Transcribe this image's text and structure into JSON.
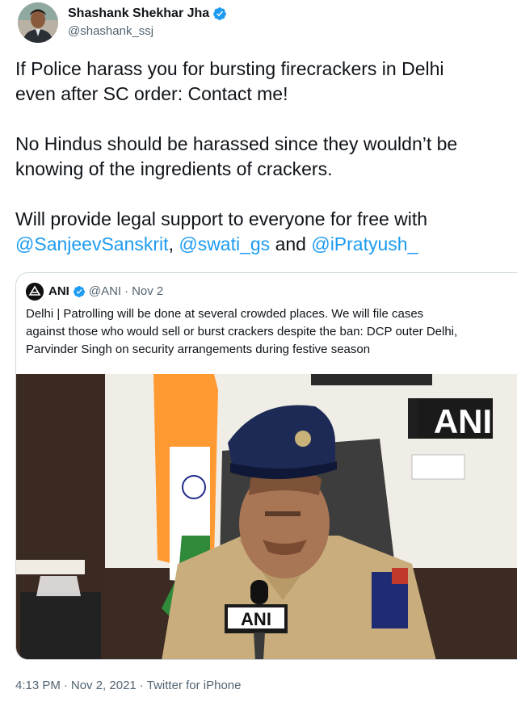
{
  "author": {
    "name": "Shashank Shekhar Jha",
    "handle": "@shashank_ssj"
  },
  "tweet": {
    "line1": "If Police harass you for bursting firecrackers in Delhi",
    "line2": "even after SC order: Contact me!",
    "line3": "No Hindus should be harassed since they wouldn’t be",
    "line4": "knowing of the ingredients of crackers.",
    "line5": "Will provide legal support to everyone for free with",
    "mention1": "@SanjeevSanskrit",
    "comma": ",",
    "mention2": "@swati_gs",
    "and": "and",
    "mention3": "@iPratyush_"
  },
  "quoted": {
    "name": "ANI",
    "handle": "@ANI",
    "dot": "·",
    "date": "Nov 2",
    "line1": "Delhi | Patrolling will be done at several crowded places. We will file cases",
    "line2": "against those who would sell or burst crackers despite the ban: DCP outer Delhi,",
    "line3": "Parvinder Singh on security arrangements during festive season",
    "watermark": "ANI",
    "mic_label": "ANI"
  },
  "footer": {
    "time": "4:13 PM",
    "dot1": "·",
    "date": "Nov 2, 2021",
    "dot2": "·",
    "source": "Twitter for iPhone"
  },
  "colors": {
    "link": "#1d9bf0",
    "secondary": "#536471",
    "verified": "#1d9bf0"
  },
  "icons": {
    "verified": "verified-badge-icon"
  }
}
